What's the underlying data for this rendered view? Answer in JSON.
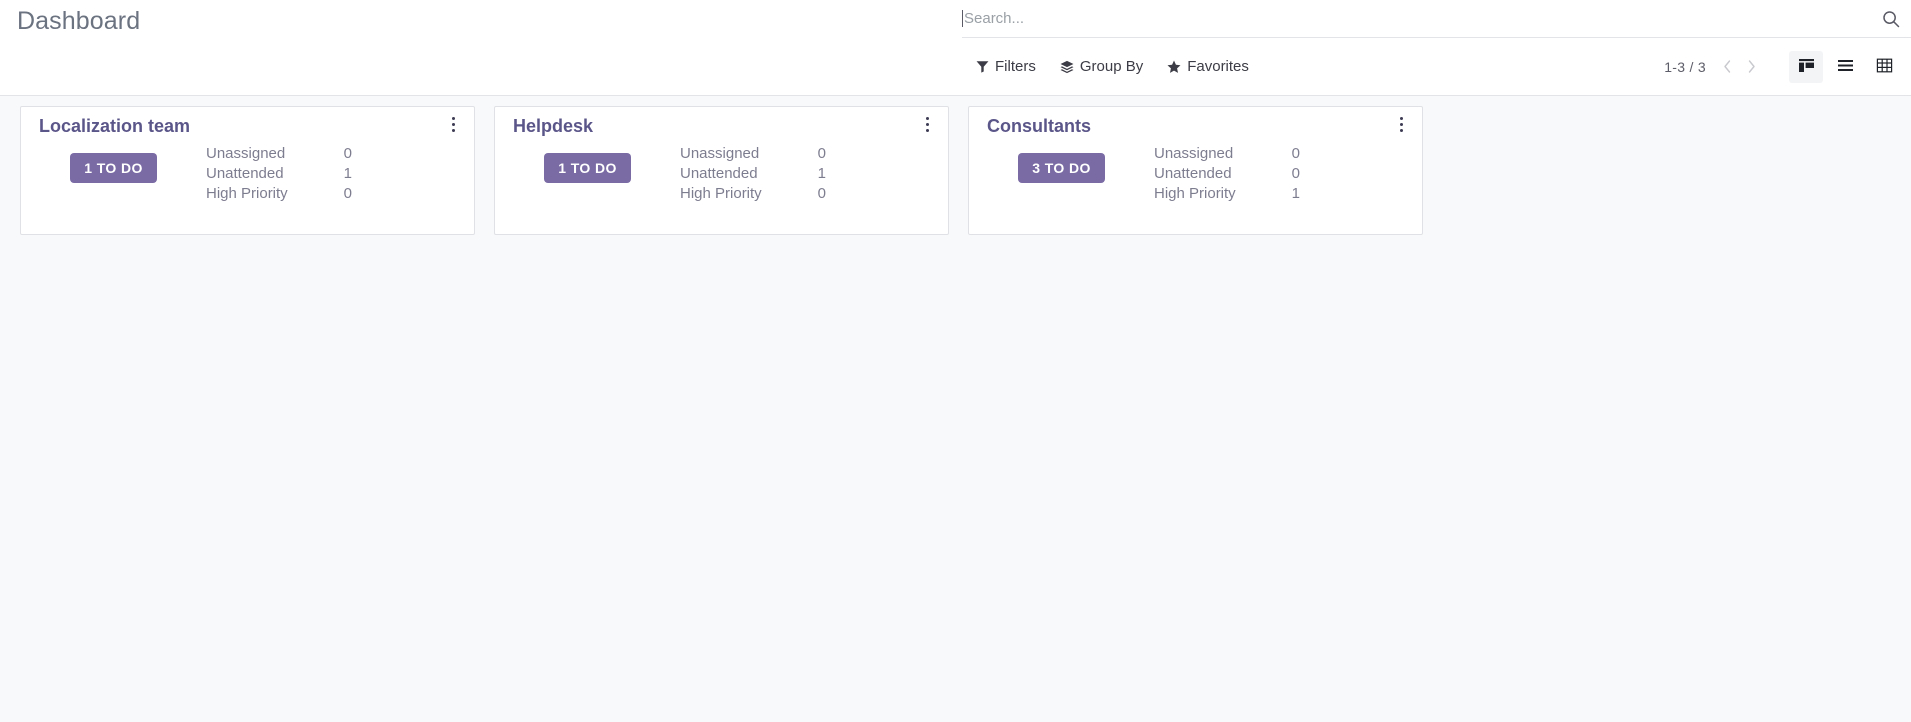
{
  "header": {
    "title": "Dashboard"
  },
  "search": {
    "placeholder": "Search...",
    "value": "",
    "icon": "search-icon"
  },
  "controls": {
    "filters": {
      "label": "Filters",
      "icon": "filter-funnel-icon"
    },
    "group_by": {
      "label": "Group By",
      "icon": "layers-icon"
    },
    "favorites": {
      "label": "Favorites",
      "icon": "star-icon"
    },
    "pager": {
      "text": "1-3 / 3",
      "prev_icon": "chevron-left-icon",
      "next_icon": "chevron-right-icon"
    },
    "views": [
      {
        "name": "kanban",
        "icon": "kanban-icon",
        "active": true
      },
      {
        "name": "list",
        "icon": "list-icon",
        "active": false
      },
      {
        "name": "pivot",
        "icon": "pivot-grid-icon",
        "active": false
      }
    ]
  },
  "colors": {
    "accent_purple": "#7a6ba5",
    "card_title": "#5b5689",
    "page_bg": "#F8F9FA",
    "card_bg": "#ffffff",
    "card_border": "#e0e1e6",
    "muted_text": "#7d7d90"
  },
  "cards": [
    {
      "title": "Localization team",
      "todo_label": "1 TO DO",
      "menu_icon": "kebab-menu-icon",
      "stats": [
        {
          "label": "Unassigned",
          "value": "0"
        },
        {
          "label": "Unattended",
          "value": "1"
        },
        {
          "label": "High Priority",
          "value": "0"
        }
      ]
    },
    {
      "title": "Helpdesk",
      "todo_label": "1 TO DO",
      "menu_icon": "kebab-menu-icon",
      "stats": [
        {
          "label": "Unassigned",
          "value": "0"
        },
        {
          "label": "Unattended",
          "value": "1"
        },
        {
          "label": "High Priority",
          "value": "0"
        }
      ]
    },
    {
      "title": "Consultants",
      "todo_label": "3 TO DO",
      "menu_icon": "kebab-menu-icon",
      "stats": [
        {
          "label": "Unassigned",
          "value": "0"
        },
        {
          "label": "Unattended",
          "value": "0"
        },
        {
          "label": "High Priority",
          "value": "1"
        }
      ]
    }
  ]
}
